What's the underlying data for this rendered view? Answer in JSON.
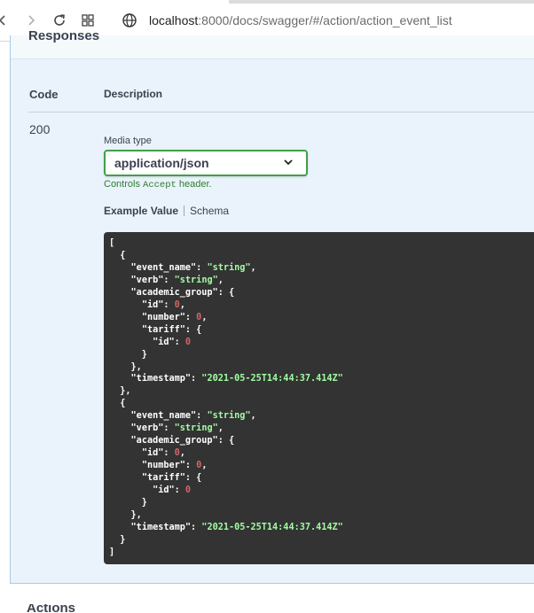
{
  "browser": {
    "url_host": "localhost",
    "url_path": ":8000/docs/swagger/#/action/action_event_list",
    "icons": [
      "back-icon",
      "forward-icon",
      "reload-icon",
      "apps-icon",
      "globe-icon"
    ]
  },
  "responses": {
    "title": "Responses",
    "col_code": "Code",
    "col_description": "Description",
    "rows": [
      {
        "code": "200",
        "media_type_label": "Media type",
        "media_type_value": "application/json",
        "controls_prefix": "Controls ",
        "controls_code": "Accept",
        "controls_suffix": " header.",
        "tab_example": "Example Value",
        "tab_schema": "Schema"
      }
    ]
  },
  "example": {
    "events": [
      {
        "event_name": "string",
        "verb": "string",
        "group_id": "0",
        "group_number": "0",
        "tariff_id": "0",
        "timestamp": "2021-05-25T14:44:37.414Z"
      },
      {
        "event_name": "string",
        "verb": "string",
        "group_id": "0",
        "group_number": "0",
        "tariff_id": "0",
        "timestamp": "2021-05-25T14:44:37.414Z"
      }
    ]
  },
  "next_section": "Actions",
  "colors": {
    "accent_green": "#41a047",
    "panel_bg": "#eaf3fb",
    "code_bg": "#333333",
    "string_green": "#a2fca2",
    "number_red": "#d36363"
  }
}
